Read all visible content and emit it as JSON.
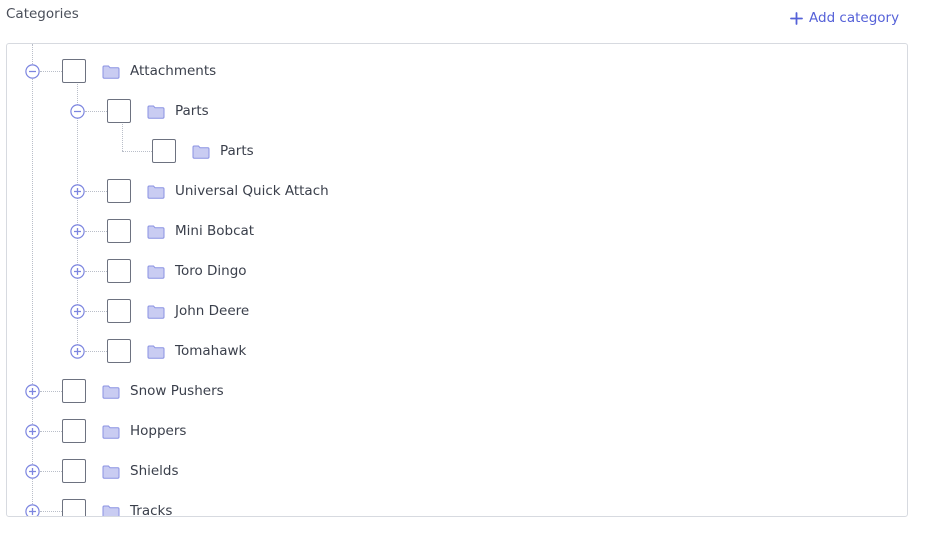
{
  "header": {
    "title": "Categories",
    "add_label": "Add category",
    "add_icon": "plus-icon",
    "accent_color": "#5561d8"
  },
  "tree": {
    "toggle_icons": {
      "expanded": "minus-circle-icon",
      "collapsed": "plus-circle-icon"
    },
    "folder_icon": "folder-icon",
    "folder_color": "#c9ccf2",
    "items": [
      {
        "label": "Attachments",
        "level": 0,
        "state": "expanded"
      },
      {
        "label": "Parts",
        "level": 1,
        "state": "expanded"
      },
      {
        "label": "Parts",
        "level": 2,
        "state": "leaf"
      },
      {
        "label": "Universal Quick Attach",
        "level": 1,
        "state": "collapsed"
      },
      {
        "label": "Mini Bobcat",
        "level": 1,
        "state": "collapsed"
      },
      {
        "label": "Toro Dingo",
        "level": 1,
        "state": "collapsed"
      },
      {
        "label": "John Deere",
        "level": 1,
        "state": "collapsed"
      },
      {
        "label": "Tomahawk",
        "level": 1,
        "state": "collapsed"
      },
      {
        "label": "Snow Pushers",
        "level": 0,
        "state": "collapsed"
      },
      {
        "label": "Hoppers",
        "level": 0,
        "state": "collapsed"
      },
      {
        "label": "Shields",
        "level": 0,
        "state": "collapsed"
      },
      {
        "label": "Tracks",
        "level": 0,
        "state": "collapsed"
      }
    ]
  }
}
